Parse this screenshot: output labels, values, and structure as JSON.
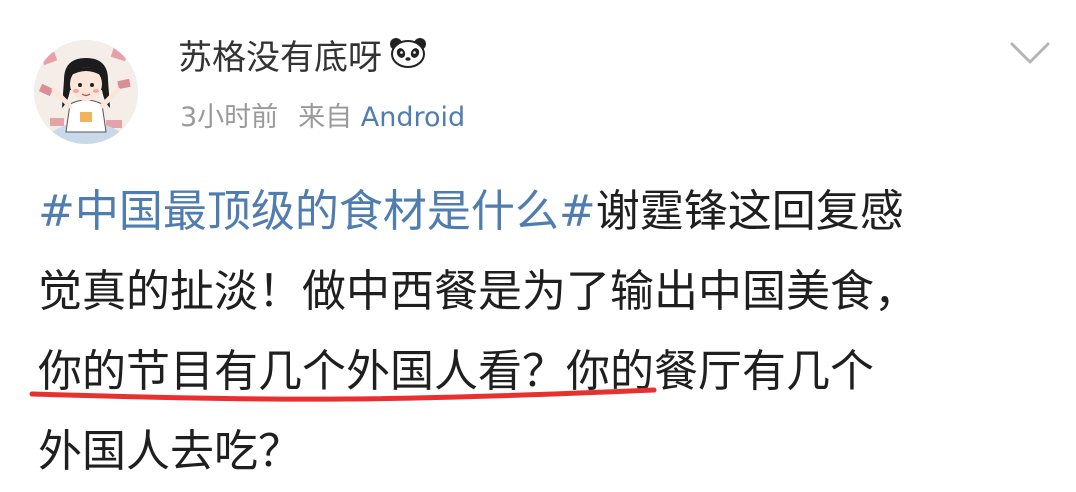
{
  "post": {
    "username": "苏格没有底呀",
    "username_icon": "panda-face-icon",
    "time": "3小时前",
    "source_prefix": "来自",
    "source_app": "Android",
    "menu_icon": "chevron-down-icon",
    "hashtag": "#中国最顶级的食材是什么#",
    "text_line1_rest": "谢霆锋这回复感",
    "text_line2": "觉真的扯淡！做中西餐是为了输出中国美食，",
    "text_line3": "你的节目有几个外国人看？你的餐厅有几个",
    "text_line4": "外国人去吃？"
  },
  "colors": {
    "link_blue": "#507daf",
    "body_text": "#1f1f1f",
    "meta_gray": "#9a9a9a",
    "annotation_red": "#e8302f"
  }
}
